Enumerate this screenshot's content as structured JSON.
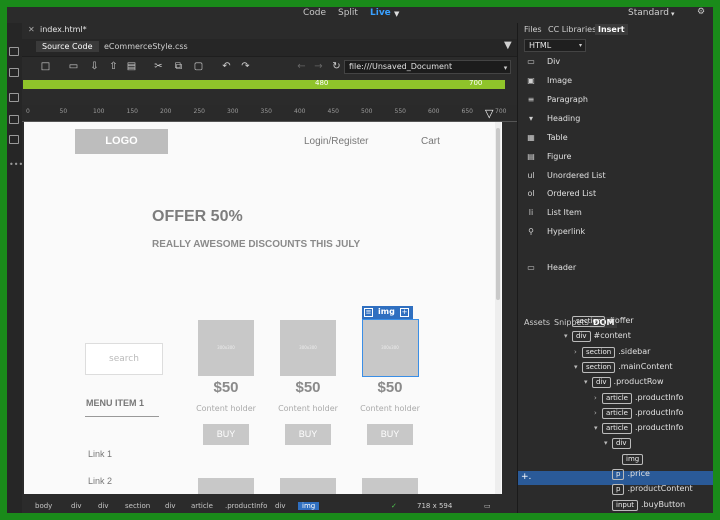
{
  "topbar": {
    "views": [
      "Code",
      "Split",
      "Live"
    ],
    "workspace": "Standard"
  },
  "doc": {
    "tab_title": "index.html*",
    "subtabs": [
      "Source Code",
      "eCommerceStyle.css"
    ],
    "url": "file:///Unsaved_Document"
  },
  "media_query": {
    "left": "480",
    "right": "700"
  },
  "ruler": [
    "0",
    "50",
    "100",
    "150",
    "200",
    "250",
    "300",
    "350",
    "400",
    "450",
    "500",
    "550",
    "600",
    "650",
    "700"
  ],
  "page": {
    "logo": "LOGO",
    "nav": [
      "Login/Register",
      "Cart"
    ],
    "offer_title": "OFFER 50%",
    "offer_sub": "REALLY AWESOME DISCOUNTS THIS JULY",
    "search_placeholder": "search",
    "menu_item": "MENU ITEM 1",
    "links": [
      "Link 1",
      "Link 2"
    ],
    "products": [
      {
        "img": "300x300",
        "price": "$50",
        "holder": "Content holder",
        "buy": "BUY"
      },
      {
        "img": "300x300",
        "price": "$50",
        "holder": "Content holder",
        "buy": "BUY"
      },
      {
        "img": "300x300",
        "price": "$50",
        "holder": "Content holder",
        "buy": "BUY"
      }
    ],
    "selected_tag": "img"
  },
  "statusbar": {
    "breadcrumbs": [
      "body",
      "div",
      "div",
      "section",
      "div",
      "article",
      ".productInfo",
      "div",
      "img"
    ],
    "dimensions": "718 x 594"
  },
  "panel": {
    "top_tabs": [
      "Files",
      "CC Libraries",
      "Insert"
    ],
    "html_select": "HTML",
    "insert_items": [
      {
        "icon": "div-icon",
        "glyph": "▭",
        "label": "Div"
      },
      {
        "icon": "image-icon",
        "glyph": "▣",
        "label": "Image"
      },
      {
        "icon": "paragraph-icon",
        "glyph": "≡",
        "label": "Paragraph"
      },
      {
        "icon": "heading-icon",
        "glyph": "▾",
        "label": "Heading"
      },
      {
        "icon": "table-icon",
        "glyph": "▦",
        "label": "Table"
      },
      {
        "icon": "figure-icon",
        "glyph": "▤",
        "label": "Figure"
      },
      {
        "icon": "unordered-list-icon",
        "glyph": "ul",
        "label": "Unordered List"
      },
      {
        "icon": "ordered-list-icon",
        "glyph": "ol",
        "label": "Ordered List"
      },
      {
        "icon": "list-item-icon",
        "glyph": "li",
        "label": "List Item"
      },
      {
        "icon": "hyperlink-icon",
        "glyph": "⚲",
        "label": "Hyperlink"
      },
      {
        "icon": "header-icon",
        "glyph": "▭",
        "label": "Header"
      }
    ],
    "dom_tabs": [
      "Assets",
      "Snippets",
      "DOM"
    ],
    "dom_nodes": [
      {
        "indent": 0,
        "arrow": "",
        "tag": "section",
        "label": "#offer"
      },
      {
        "indent": 0,
        "arrow": "▾",
        "tag": "div",
        "label": "#content"
      },
      {
        "indent": 1,
        "arrow": "›",
        "tag": "section",
        "label": ".sidebar"
      },
      {
        "indent": 1,
        "arrow": "▾",
        "tag": "section",
        "label": ".mainContent"
      },
      {
        "indent": 2,
        "arrow": "▾",
        "tag": "div",
        "label": ".productRow"
      },
      {
        "indent": 3,
        "arrow": "›",
        "tag": "article",
        "label": ".productInfo"
      },
      {
        "indent": 3,
        "arrow": "›",
        "tag": "article",
        "label": ".productInfo"
      },
      {
        "indent": 3,
        "arrow": "▾",
        "tag": "article",
        "label": ".productInfo"
      },
      {
        "indent": 4,
        "arrow": "▾",
        "tag": "div",
        "label": ""
      },
      {
        "indent": 5,
        "arrow": "",
        "tag": "img",
        "label": ""
      },
      {
        "indent": 4,
        "arrow": "",
        "tag": "p",
        "label": ".price"
      },
      {
        "indent": 4,
        "arrow": "",
        "tag": "p",
        "label": ".productContent"
      },
      {
        "indent": 4,
        "arrow": "",
        "tag": "input",
        "label": ".buyButton"
      }
    ]
  }
}
